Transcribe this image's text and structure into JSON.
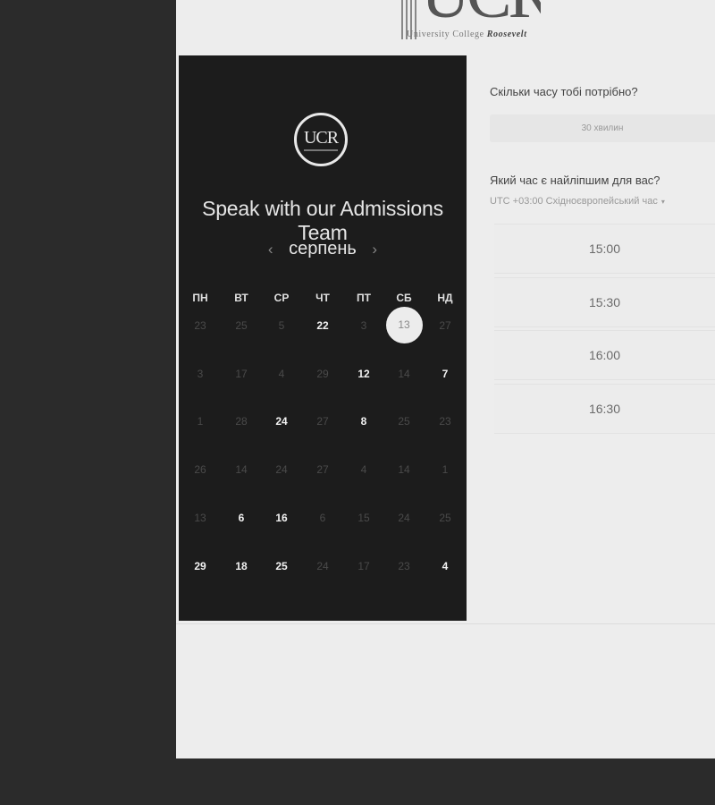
{
  "header": {
    "logo_mark": "UCR",
    "logo_subtitle": "University College",
    "logo_subtitle_italic": "Roosevelt"
  },
  "calendar": {
    "logo_text": "UCR",
    "title": "Speak with our Admissions Team",
    "month": "серпень",
    "prev_arrow": "‹",
    "next_arrow": "›",
    "weekdays": [
      "ПН",
      "ВТ",
      "СР",
      "ЧТ",
      "ПТ",
      "СБ",
      "НД"
    ],
    "weeks": [
      [
        {
          "d": "23",
          "s": "off"
        },
        {
          "d": "25",
          "s": "off"
        },
        {
          "d": "5",
          "s": "off"
        },
        {
          "d": "22",
          "s": "on"
        },
        {
          "d": "3",
          "s": "off"
        },
        {
          "d": "13",
          "s": "sel"
        },
        {
          "d": "27",
          "s": "off"
        }
      ],
      [
        {
          "d": "3",
          "s": "off"
        },
        {
          "d": "17",
          "s": "off"
        },
        {
          "d": "4",
          "s": "off"
        },
        {
          "d": "29",
          "s": "off"
        },
        {
          "d": "12",
          "s": "on"
        },
        {
          "d": "14",
          "s": "off"
        },
        {
          "d": "7",
          "s": "on"
        }
      ],
      [
        {
          "d": "1",
          "s": "off"
        },
        {
          "d": "28",
          "s": "off"
        },
        {
          "d": "24",
          "s": "on"
        },
        {
          "d": "27",
          "s": "off"
        },
        {
          "d": "8",
          "s": "on"
        },
        {
          "d": "25",
          "s": "off"
        },
        {
          "d": "23",
          "s": "off"
        }
      ],
      [
        {
          "d": "26",
          "s": "off"
        },
        {
          "d": "14",
          "s": "off"
        },
        {
          "d": "24",
          "s": "off"
        },
        {
          "d": "27",
          "s": "off"
        },
        {
          "d": "4",
          "s": "off"
        },
        {
          "d": "14",
          "s": "off"
        },
        {
          "d": "1",
          "s": "off"
        }
      ],
      [
        {
          "d": "13",
          "s": "off"
        },
        {
          "d": "6",
          "s": "on"
        },
        {
          "d": "16",
          "s": "on"
        },
        {
          "d": "6",
          "s": "off"
        },
        {
          "d": "15",
          "s": "off"
        },
        {
          "d": "24",
          "s": "off"
        },
        {
          "d": "25",
          "s": "off"
        }
      ],
      [
        {
          "d": "29",
          "s": "on"
        },
        {
          "d": "18",
          "s": "on"
        },
        {
          "d": "25",
          "s": "on"
        },
        {
          "d": "24",
          "s": "off"
        },
        {
          "d": "17",
          "s": "off"
        },
        {
          "d": "23",
          "s": "off"
        },
        {
          "d": "4",
          "s": "on"
        }
      ]
    ]
  },
  "booking": {
    "duration_question": "Скільки часу тобі потрібно?",
    "duration_value": "30 хвилин",
    "time_question": "Який час є найліпшим для вас?",
    "timezone": "UTC +03:00 Східноєвропейський час",
    "timezone_caret": "▾",
    "slots": [
      "15:00",
      "15:30",
      "16:00",
      "16:30"
    ]
  }
}
